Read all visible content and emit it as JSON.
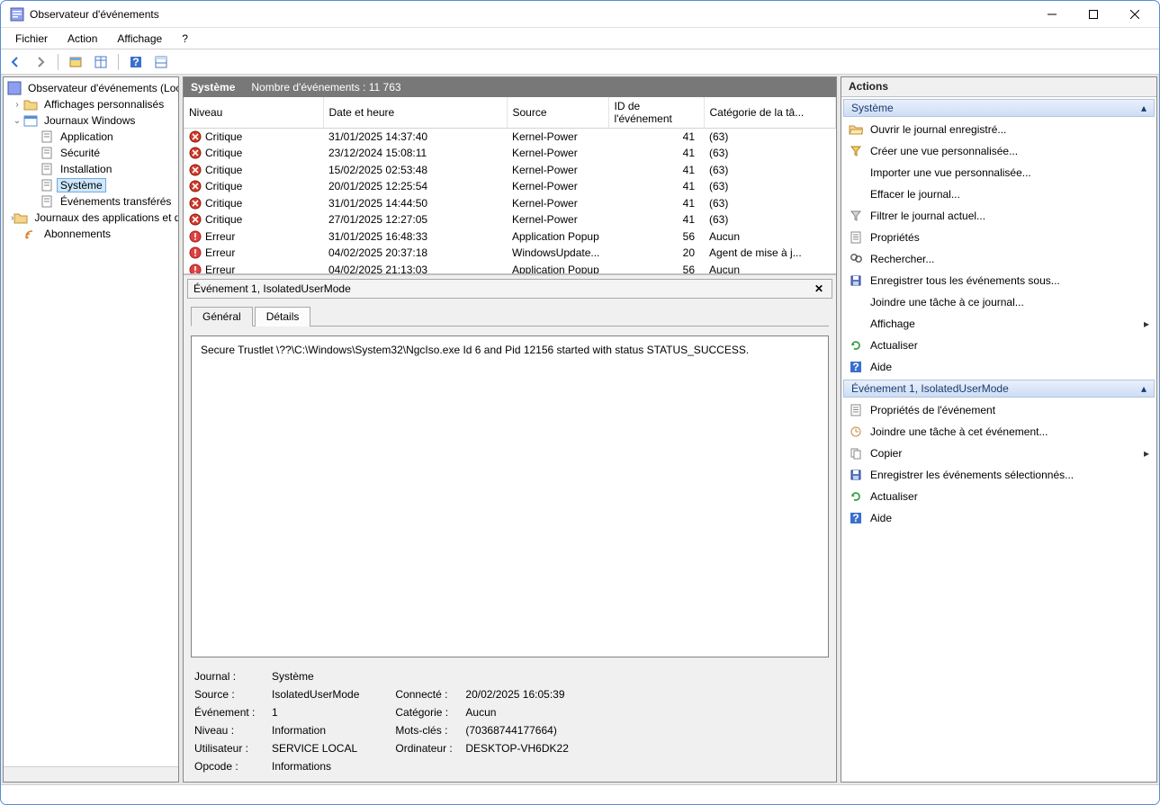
{
  "window": {
    "title": "Observateur d'événements"
  },
  "menu": {
    "file": "Fichier",
    "action": "Action",
    "view": "Affichage",
    "help": "?"
  },
  "tree": {
    "root": "Observateur d'événements (Local)",
    "custom_views": "Affichages personnalisés",
    "windows_logs": "Journaux Windows",
    "application": "Application",
    "security": "Sécurité",
    "setup": "Installation",
    "system": "Système",
    "forwarded": "Événements transférés",
    "app_services": "Journaux des applications et des services",
    "subscriptions": "Abonnements"
  },
  "center": {
    "title": "Système",
    "count_label": "Nombre d'événements : 11 763",
    "columns": {
      "level": "Niveau",
      "date": "Date et heure",
      "source": "Source",
      "id": "ID de l'événement",
      "cat": "Catégorie de la tâ..."
    },
    "rows": [
      {
        "level": "Critique",
        "icon": "critical",
        "date": "31/01/2025 14:37:40",
        "source": "Kernel-Power",
        "id": "41",
        "cat": "(63)"
      },
      {
        "level": "Critique",
        "icon": "critical",
        "date": "23/12/2024 15:08:11",
        "source": "Kernel-Power",
        "id": "41",
        "cat": "(63)"
      },
      {
        "level": "Critique",
        "icon": "critical",
        "date": "15/02/2025 02:53:48",
        "source": "Kernel-Power",
        "id": "41",
        "cat": "(63)"
      },
      {
        "level": "Critique",
        "icon": "critical",
        "date": "20/01/2025 12:25:54",
        "source": "Kernel-Power",
        "id": "41",
        "cat": "(63)"
      },
      {
        "level": "Critique",
        "icon": "critical",
        "date": "31/01/2025 14:44:50",
        "source": "Kernel-Power",
        "id": "41",
        "cat": "(63)"
      },
      {
        "level": "Critique",
        "icon": "critical",
        "date": "27/01/2025 12:27:05",
        "source": "Kernel-Power",
        "id": "41",
        "cat": "(63)"
      },
      {
        "level": "Erreur",
        "icon": "error",
        "date": "31/01/2025 16:48:33",
        "source": "Application Popup",
        "id": "56",
        "cat": "Aucun"
      },
      {
        "level": "Erreur",
        "icon": "error",
        "date": "04/02/2025 20:37:18",
        "source": "WindowsUpdate...",
        "id": "20",
        "cat": "Agent de mise à j..."
      },
      {
        "level": "Erreur",
        "icon": "error",
        "date": "04/02/2025 21:13:03",
        "source": "Application Popup",
        "id": "56",
        "cat": "Aucun"
      }
    ]
  },
  "detail": {
    "header": "Événement 1, IsolatedUserMode",
    "tabs": {
      "general": "Général",
      "details": "Détails"
    },
    "message": "Secure Trustlet \\??\\C:\\Windows\\System32\\NgcIso.exe Id 6 and Pid 12156 started with status STATUS_SUCCESS.",
    "props": {
      "journal_l": "Journal :",
      "journal_v": "Système",
      "source_l": "Source :",
      "source_v": "IsolatedUserMode",
      "event_l": "Événement :",
      "event_v": "1",
      "level_l": "Niveau :",
      "level_v": "Information",
      "user_l": "Utilisateur :",
      "user_v": "SERVICE LOCAL",
      "opcode_l": "Opcode :",
      "opcode_v": "Informations",
      "logged_l": "Connecté :",
      "logged_v": "20/02/2025 16:05:39",
      "category_l": "Catégorie :",
      "category_v": "Aucun",
      "keywords_l": "Mots-clés :",
      "keywords_v": "(70368744177664)",
      "computer_l": "Ordinateur :",
      "computer_v": "DESKTOP-VH6DK22"
    }
  },
  "actions": {
    "header": "Actions",
    "group_system": "Système",
    "group_event": "Événement 1, IsolatedUserMode",
    "system_items": [
      {
        "icon": "folder-open",
        "label": "Ouvrir le journal enregistré..."
      },
      {
        "icon": "funnel",
        "label": "Créer une vue personnalisée..."
      },
      {
        "icon": "blank",
        "label": "Importer une vue personnalisée..."
      },
      {
        "icon": "blank",
        "label": "Effacer le journal..."
      },
      {
        "icon": "funnel-sm",
        "label": "Filtrer le journal actuel..."
      },
      {
        "icon": "props",
        "label": "Propriétés"
      },
      {
        "icon": "find",
        "label": "Rechercher..."
      },
      {
        "icon": "save",
        "label": "Enregistrer tous les événements sous..."
      },
      {
        "icon": "blank",
        "label": "Joindre une tâche à ce journal..."
      },
      {
        "icon": "blank",
        "label": "Affichage",
        "submenu": true
      },
      {
        "icon": "refresh",
        "label": "Actualiser"
      },
      {
        "icon": "help",
        "label": "Aide"
      }
    ],
    "event_items": [
      {
        "icon": "props",
        "label": "Propriétés de l'événement"
      },
      {
        "icon": "task",
        "label": "Joindre une tâche à cet événement..."
      },
      {
        "icon": "copy",
        "label": "Copier",
        "submenu": true
      },
      {
        "icon": "save",
        "label": "Enregistrer les événements sélectionnés..."
      },
      {
        "icon": "refresh",
        "label": "Actualiser"
      },
      {
        "icon": "help",
        "label": "Aide"
      }
    ]
  }
}
